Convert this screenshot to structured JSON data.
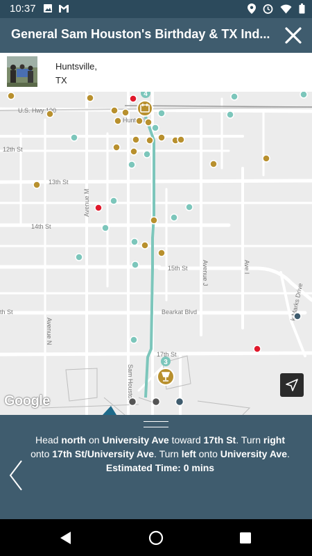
{
  "status_bar": {
    "time": "10:37",
    "left_icons": [
      "image-icon",
      "gmail-icon"
    ],
    "right_icons": [
      "location-icon",
      "alarm-icon",
      "wifi-icon",
      "battery-icon"
    ]
  },
  "header": {
    "title": "General Sam Houston's Birthday & TX Ind..."
  },
  "location": {
    "city_line1": "Huntsville,",
    "city_line2": "TX"
  },
  "map": {
    "labels": {
      "us_hwy": "U.S. Hwy 190",
      "huntsville": "Huntsville",
      "st12": "12th St",
      "st13": "13th St",
      "st14": "14th St",
      "st15": "15th St",
      "st17": "17th St",
      "bearkat": "Bearkat Blvd",
      "ave_m": "Avenue M",
      "ave_n": "Avenue N",
      "ave_j": "Avenue J",
      "ave_i": "Ave I",
      "th_st": "th St",
      "sam_houston": "Sam Houston",
      "marks": "k Marks Drive"
    },
    "route_markers": [
      "4",
      "3"
    ],
    "colors": {
      "route": "#7cc6bb",
      "poi_gold": "#b8902e",
      "poi_teal": "#7cc6bb",
      "poi_red": "#e0192c",
      "poi_gray": "#555555",
      "poi_navy": "#3f5c6e"
    },
    "google_logo": "Google"
  },
  "directions": {
    "p1": "Head ",
    "b1": "north",
    "p2": " on ",
    "b2": "University Ave",
    "p3": " toward ",
    "b3": "17th St",
    "p4": ". Turn ",
    "b4": "right",
    "p5": " onto ",
    "b5": "17th St/University Ave",
    "p6": ". Turn ",
    "b6": "left",
    "p7": " onto ",
    "b7": "University Ave",
    "p8": ".",
    "eta": "Estimated Time: 0 mins"
  },
  "navbar": {
    "back": "back-icon",
    "home": "home-icon",
    "recents": "recents-icon"
  }
}
